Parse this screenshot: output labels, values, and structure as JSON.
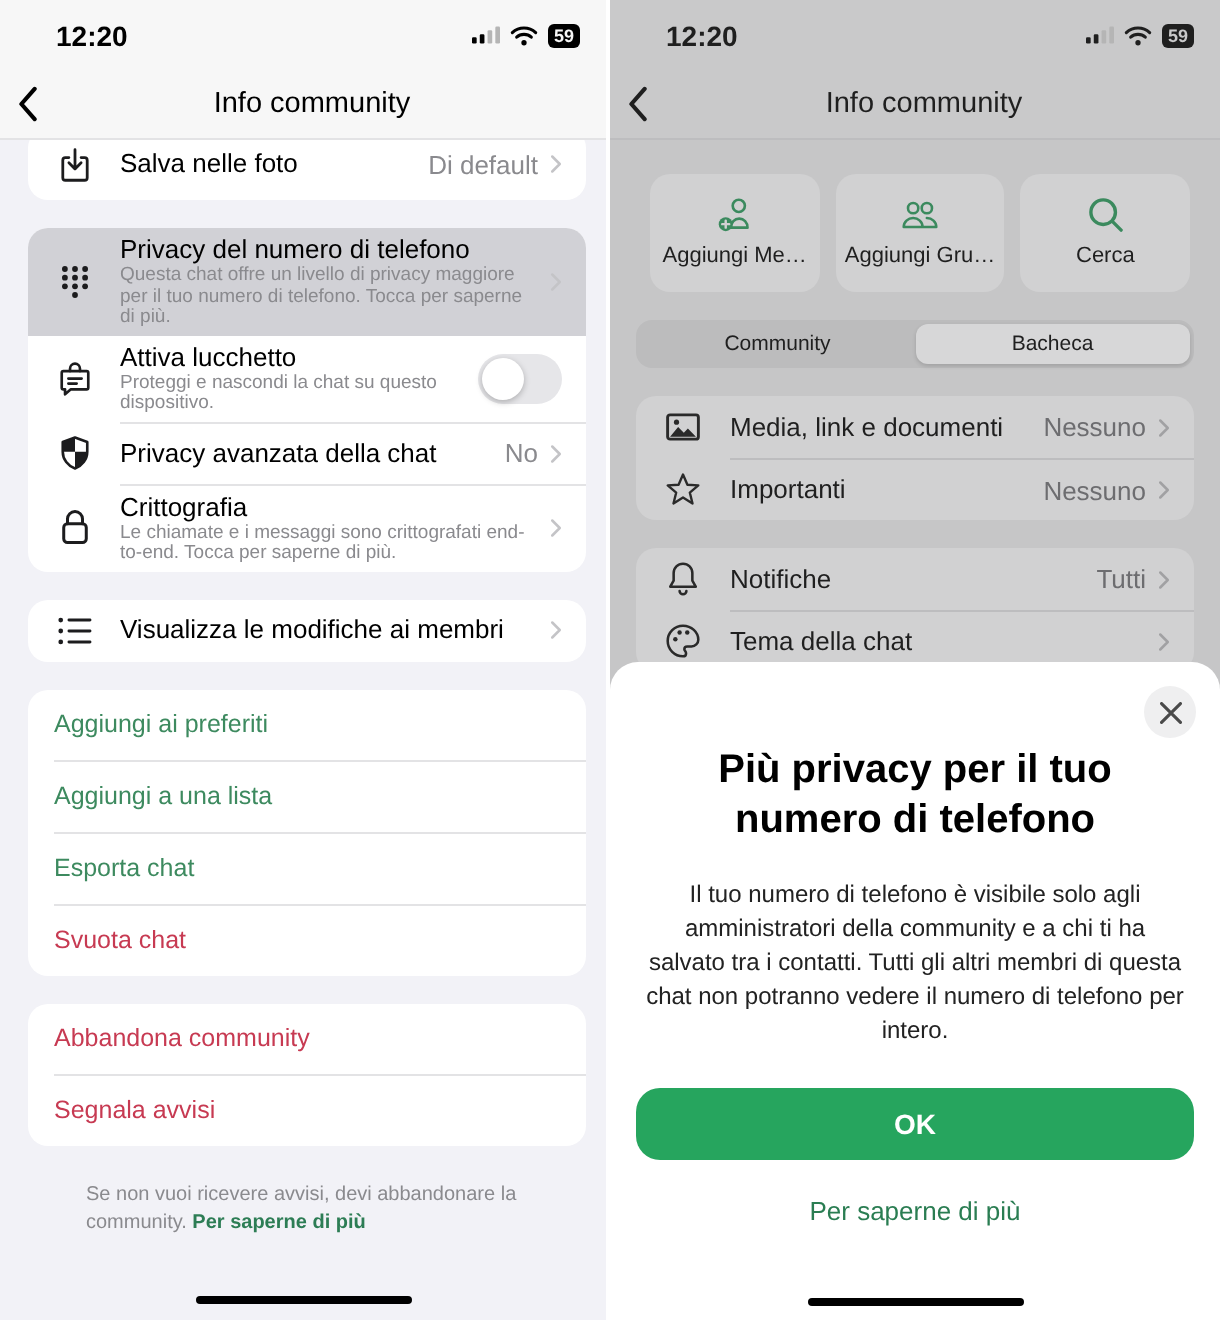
{
  "screens": [
    {
      "status_bar": {
        "time": "12:20",
        "battery": "59"
      },
      "nav": {
        "title": "Info community"
      },
      "sections": [
        {
          "rows": [
            {
              "kind": "link",
              "label": "Salva nelle foto",
              "value": "Di default"
            }
          ]
        },
        {
          "rows": [
            {
              "kind": "link",
              "label": "Privacy del numero di telefono",
              "subtitle": "Questa chat offre un livello di privacy maggiore per il tuo numero di telefono. Tocca per saperne di più.",
              "highlighted": true
            },
            {
              "kind": "toggle",
              "label": "Attiva lucchetto",
              "subtitle": "Proteggi e nascondi la chat su questo dispositivo.",
              "on": false,
              "highlighted": false
            },
            {
              "kind": "link",
              "label": "Privacy avanzata della chat",
              "value": "No",
              "highlighted": false
            },
            {
              "kind": "link",
              "label": "Crittografia",
              "subtitle": "Le chiamate e i messaggi sono crittografati end-to-end. Tocca per saperne di più.",
              "highlighted": false
            }
          ]
        },
        {
          "rows": [
            {
              "kind": "link",
              "label": "Visualizza le modifiche ai membri"
            }
          ]
        },
        {
          "rows": [
            {
              "kind": "action",
              "label": "Aggiungi ai preferiti",
              "color": "#3d8a5f"
            },
            {
              "kind": "action",
              "label": "Aggiungi a una lista",
              "color": "#3d8a5f"
            },
            {
              "kind": "action",
              "label": "Esporta chat",
              "color": "#3d8a5f"
            },
            {
              "kind": "action",
              "label": "Svuota chat",
              "color": "#c73a52"
            }
          ]
        },
        {
          "rows": [
            {
              "kind": "action",
              "label": "Abbandona community",
              "color": "#c73a52"
            },
            {
              "kind": "action",
              "label": "Segnala avvisi",
              "color": "#c73a52"
            }
          ]
        }
      ],
      "footer": {
        "text": "Se non vuoi ricevere avvisi, devi abbandonare la community.",
        "link": "Per saperne di più"
      }
    },
    {
      "status_bar": {
        "time": "12:20",
        "battery": "59"
      },
      "nav": {
        "title": "Info community"
      },
      "actions": [
        {
          "label": "Aggiungi Me…"
        },
        {
          "label": "Aggiungi Gru…"
        },
        {
          "label": "Cerca"
        }
      ],
      "segments": [
        {
          "label": "Community",
          "selected": false
        },
        {
          "label": "Bacheca",
          "selected": true
        }
      ],
      "sections": [
        {
          "rows": [
            {
              "kind": "link",
              "label": "Media, link e documenti",
              "value": "Nessuno"
            },
            {
              "kind": "link",
              "label": "Importanti",
              "value": "Nessuno"
            }
          ]
        },
        {
          "rows": [
            {
              "kind": "link",
              "label": "Notifiche",
              "value": "Tutti"
            },
            {
              "kind": "link",
              "label": "Tema della chat"
            }
          ]
        }
      ],
      "sheet": {
        "title": "Più privacy per il tuo numero di telefono",
        "body": "Il tuo numero di telefono è visibile solo agli amministratori della community e a chi ti ha salvato tra i contatti. Tutti gli altri membri di questa chat non potranno vedere il numero di telefono per intero.",
        "button": "OK",
        "link": "Per saperne di più"
      }
    }
  ]
}
